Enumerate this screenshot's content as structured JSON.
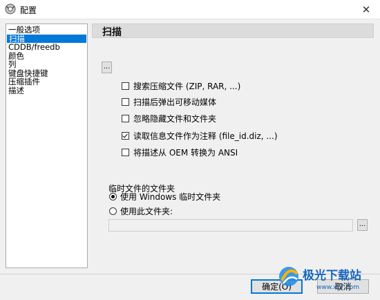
{
  "window": {
    "title": "配置",
    "close_symbol": "✕"
  },
  "nav": {
    "items": [
      {
        "label": "一般选项"
      },
      {
        "label": "扫描"
      },
      {
        "label": "CDDB/freedb"
      },
      {
        "label": "颜色"
      },
      {
        "label": "列"
      },
      {
        "label": "键盘快捷键"
      },
      {
        "label": "压缩插件"
      },
      {
        "label": "描述"
      }
    ],
    "selected_index": 1
  },
  "section": {
    "title": "扫描"
  },
  "scan_options": {
    "browse_label": "...",
    "items": [
      {
        "label": "搜索压缩文件 (ZIP, RAR, ...)",
        "checked": false
      },
      {
        "label": "扫描后弹出可移动媒体",
        "checked": false
      },
      {
        "label": "忽略隐藏文件和文件夹",
        "checked": false
      },
      {
        "label": "读取信息文件作为注释 (file_id.diz, ...)",
        "checked": true
      },
      {
        "label": "将描述从 OEM 转换为 ANSI",
        "checked": false
      }
    ]
  },
  "temp_folder": {
    "group_title": "临时文件的文件夹",
    "options": [
      {
        "label": "使用 Windows 临时文件夹",
        "checked": true
      },
      {
        "label": "使用此文件夹:",
        "checked": false
      }
    ],
    "path_value": "",
    "browse_label": "..."
  },
  "buttons": {
    "ok": "确定(O)",
    "cancel": "取消"
  },
  "watermark": {
    "text": "极光下载站",
    "url_text": "www.xz7.com"
  }
}
